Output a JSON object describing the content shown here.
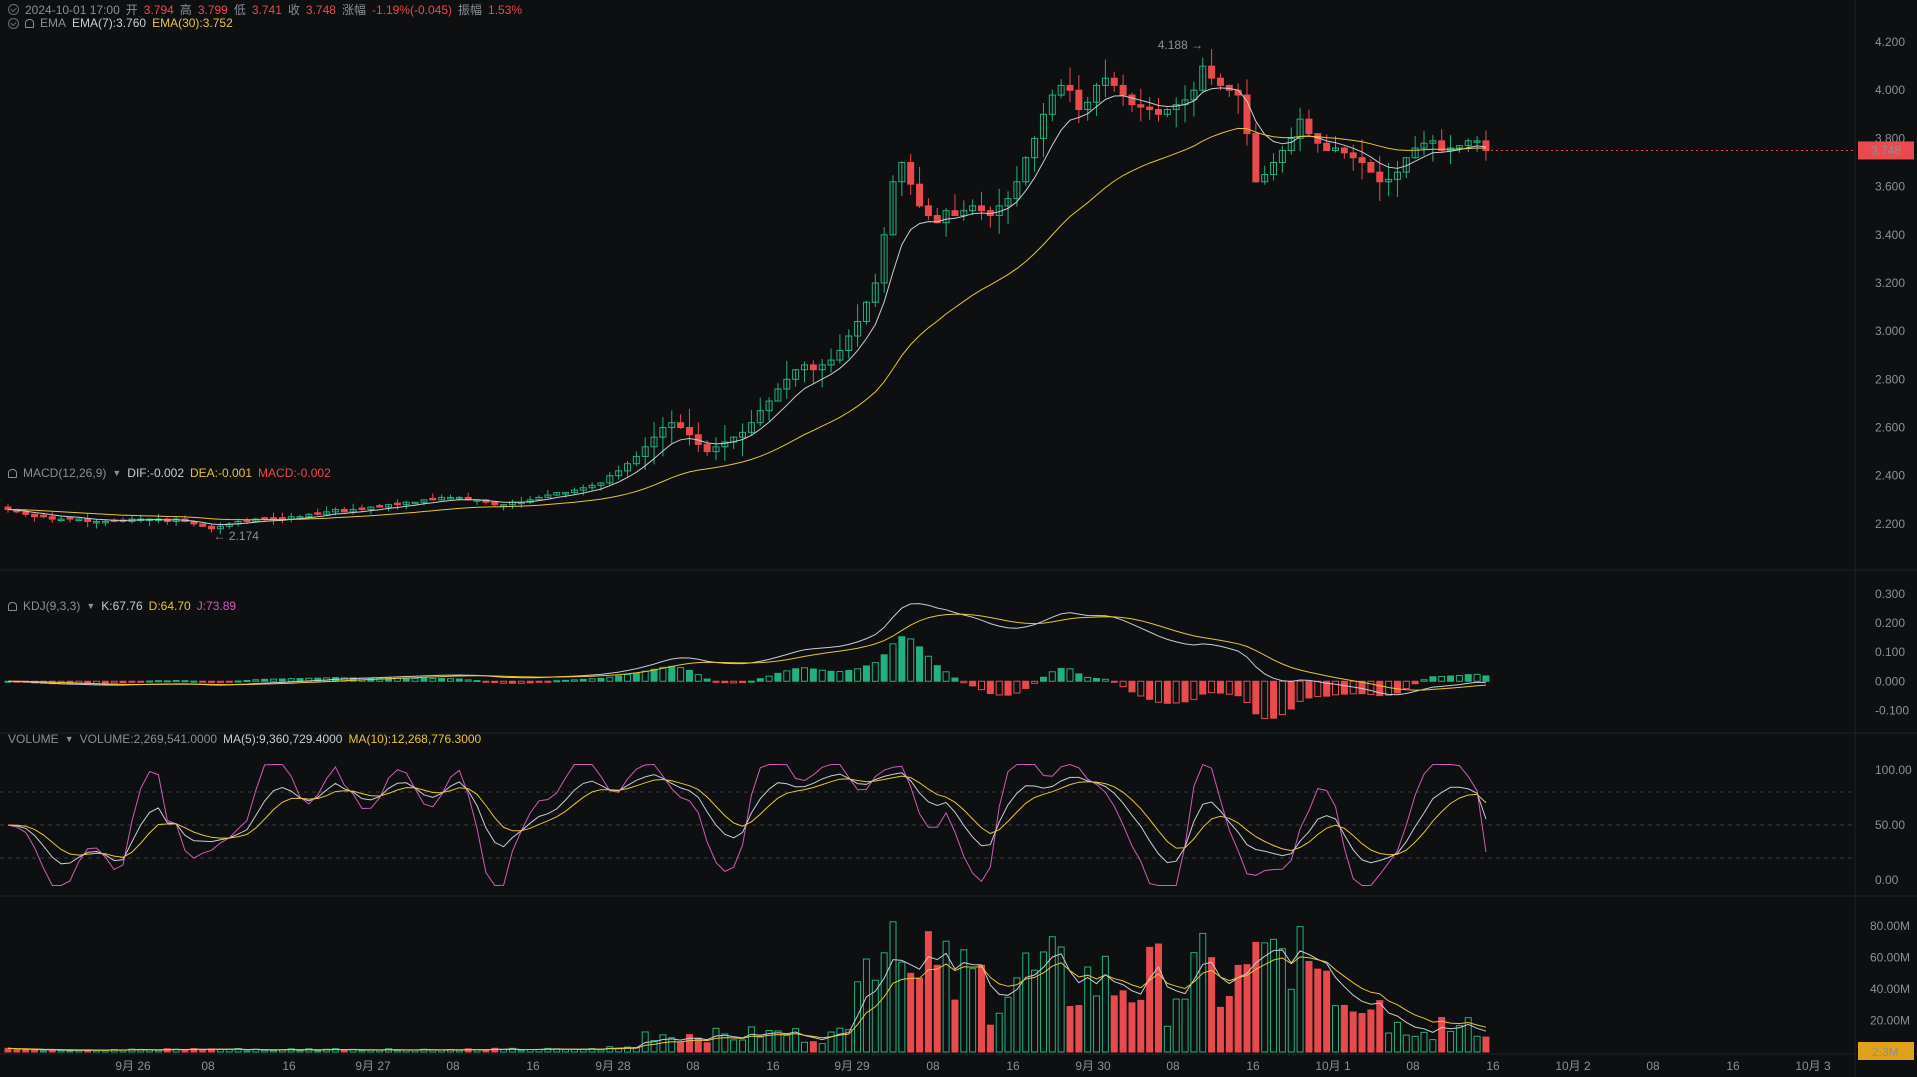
{
  "header": {
    "datetime": "2024-10-01 17:00",
    "open_label": "开",
    "open": "3.794",
    "high_label": "高",
    "high": "3.799",
    "low_label": "低",
    "low": "3.741",
    "close_label": "收",
    "close": "3.748",
    "change_label": "涨幅",
    "change": "-1.19%(-0.045)",
    "amp_label": "振幅",
    "amp": "1.53%"
  },
  "ema": {
    "label": "EMA",
    "ema7": "EMA(7):3.760",
    "ema30": "EMA(30):3.752"
  },
  "macd": {
    "label": "MACD(12,26,9)",
    "dif": "DIF:-0.002",
    "dea": "DEA:-0.001",
    "macd": "MACD:-0.002"
  },
  "kdj": {
    "label": "KDJ(9,3,3)",
    "k": "K:67.76",
    "d": "D:64.70",
    "j": "J:73.89"
  },
  "volume": {
    "label": "VOLUME",
    "vol": "VOLUME:2,269,541.0000",
    "ma5": "MA(5):9,360,729.4000",
    "ma10": "MA(10):12,268,776.3000"
  },
  "price_badge": "3.748",
  "volume_badge": "2.3M",
  "annotations": {
    "high": "4.188",
    "low": "2.174"
  },
  "colors": {
    "up": "#e84a4e",
    "down": "#22b07c",
    "ema7": "#c9ccd1",
    "ema30": "#e6c53a",
    "kdj_j": "#d05bb8",
    "bg": "#0e0f11"
  },
  "chart_data": {
    "type": "candlestick",
    "price_axis": {
      "range": [
        2.1,
        4.25
      ],
      "ticks": [
        "2.200",
        "2.400",
        "2.600",
        "2.800",
        "3.000",
        "3.200",
        "3.400",
        "3.600",
        "3.800",
        "4.000",
        "4.200"
      ]
    },
    "macd_axis": {
      "ticks": [
        "0.300",
        "0.200",
        "0.100",
        "0.000",
        "-0.100"
      ]
    },
    "kdj_axis": {
      "ticks": [
        "100.00",
        "50.00",
        "0.00"
      ]
    },
    "volume_axis": {
      "ticks": [
        "80.00M",
        "60.00M",
        "40.00M",
        "20.00M"
      ]
    },
    "x_ticks": [
      "9月 26",
      "08",
      "16",
      "9月 27",
      "08",
      "16",
      "9月 28",
      "08",
      "16",
      "9月 29",
      "08",
      "16",
      "9月 30",
      "08",
      "16",
      "10月 1",
      "08",
      "16",
      "10月 2",
      "08",
      "16",
      "10月 3"
    ],
    "close_series": [
      2.26,
      2.25,
      2.24,
      2.23,
      2.23,
      2.22,
      2.22,
      2.22,
      2.22,
      2.21,
      2.21,
      2.21,
      2.21,
      2.21,
      2.22,
      2.22,
      2.22,
      2.22,
      2.21,
      2.22,
      2.21,
      2.2,
      2.19,
      2.18,
      2.19,
      2.2,
      2.21,
      2.21,
      2.22,
      2.22,
      2.22,
      2.22,
      2.23,
      2.23,
      2.24,
      2.24,
      2.25,
      2.26,
      2.25,
      2.26,
      2.26,
      2.27,
      2.27,
      2.28,
      2.28,
      2.29,
      2.29,
      2.3,
      2.3,
      2.31,
      2.31,
      2.31,
      2.3,
      2.3,
      2.29,
      2.28,
      2.28,
      2.29,
      2.29,
      2.3,
      2.31,
      2.32,
      2.33,
      2.33,
      2.34,
      2.35,
      2.36,
      2.37,
      2.4,
      2.42,
      2.45,
      2.48,
      2.52,
      2.56,
      2.6,
      2.62,
      2.6,
      2.57,
      2.53,
      2.5,
      2.52,
      2.54,
      2.56,
      2.58,
      2.62,
      2.67,
      2.71,
      2.76,
      2.8,
      2.84,
      2.86,
      2.84,
      2.86,
      2.88,
      2.92,
      2.98,
      3.04,
      3.12,
      3.2,
      3.4,
      3.62,
      3.7,
      3.61,
      3.52,
      3.48,
      3.45,
      3.5,
      3.48,
      3.5,
      3.52,
      3.5,
      3.48,
      3.52,
      3.55,
      3.62,
      3.72,
      3.8,
      3.9,
      3.98,
      4.02,
      4.0,
      3.92,
      3.95,
      4.02,
      4.05,
      4.02,
      3.98,
      3.94,
      3.93,
      3.92,
      3.9,
      3.92,
      3.94,
      3.96,
      4.0,
      4.1,
      4.05,
      4.02,
      4.0,
      3.98,
      3.82,
      3.62,
      3.65,
      3.7,
      3.75,
      3.8,
      3.88,
      3.82,
      3.78,
      3.75,
      3.76,
      3.74,
      3.72,
      3.7,
      3.66,
      3.62,
      3.63,
      3.66,
      3.72,
      3.76,
      3.78,
      3.79,
      3.75,
      3.76,
      3.77,
      3.79,
      3.79,
      3.75
    ],
    "macd_hist": {
      "range": [
        -0.15,
        0.33
      ]
    },
    "volume": {
      "unit": "M",
      "peak": 90
    }
  }
}
